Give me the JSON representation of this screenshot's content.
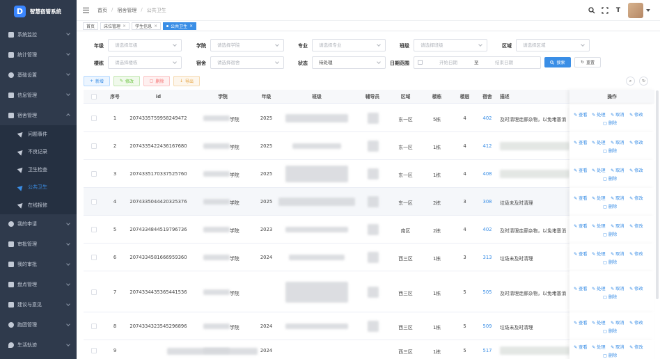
{
  "app": {
    "title": "智慧宿管系统",
    "logo_letter": "D"
  },
  "sidebar": {
    "items": [
      {
        "label": "系统监控",
        "icon": "monitor-icon"
      },
      {
        "label": "统计管理",
        "icon": "bar-chart-icon"
      },
      {
        "label": "基础设置",
        "icon": "gear-icon"
      },
      {
        "label": "信息管理",
        "icon": "document-icon"
      },
      {
        "label": "宿舍管理",
        "icon": "building-icon"
      }
    ],
    "sub_items": [
      {
        "label": "问题事件"
      },
      {
        "label": "不良记录"
      },
      {
        "label": "卫生检查"
      },
      {
        "label": "公共卫生"
      },
      {
        "label": "在线报修"
      }
    ],
    "bottom_items": [
      {
        "label": "我的申请",
        "icon": "user-icon"
      },
      {
        "label": "审批管理",
        "icon": "document-icon"
      },
      {
        "label": "我的审批",
        "icon": "document-icon"
      },
      {
        "label": "盘点管理",
        "icon": "grid-icon"
      },
      {
        "label": "建议与意见",
        "icon": "chat-icon"
      },
      {
        "label": "跑团管理",
        "icon": "gear-icon"
      },
      {
        "label": "生活轨迹",
        "icon": "pin-icon"
      }
    ]
  },
  "header": {
    "breadcrumb": [
      "首页",
      "宿舍管理",
      "公共卫生"
    ],
    "font_size_icon_text": "T"
  },
  "tabs": [
    {
      "label": "首页",
      "closable": false
    },
    {
      "label": "床位管理",
      "closable": true
    },
    {
      "label": "学生信息",
      "closable": true
    },
    {
      "label": "公共卫生",
      "closable": true,
      "active": true
    }
  ],
  "filters": {
    "grade": {
      "label": "年级",
      "placeholder": "请选择年级"
    },
    "college": {
      "label": "学院",
      "placeholder": "请选择学院"
    },
    "major": {
      "label": "专业",
      "placeholder": "请选择专业"
    },
    "class": {
      "label": "班级",
      "placeholder": "请选择班级"
    },
    "area": {
      "label": "区域",
      "placeholder": "请选择区域"
    },
    "building": {
      "label": "楼栋",
      "placeholder": "请选择楼栋"
    },
    "dorm": {
      "label": "宿舍",
      "placeholder": "请选择宿舍"
    },
    "status": {
      "label": "状态",
      "value": "待处理"
    },
    "date_range": {
      "label": "日期范围",
      "start_placeholder": "开始日期",
      "sep": "至",
      "end_placeholder": "结束日期"
    },
    "search_label": "搜索",
    "reset_label": "重置"
  },
  "toolbar": {
    "add": "新增",
    "edit": "修改",
    "delete": "删除",
    "export": "导出"
  },
  "table": {
    "columns": [
      "序号",
      "id",
      "学院",
      "年级",
      "班级",
      "辅导员",
      "区域",
      "楼栋",
      "楼层",
      "宿舍",
      "描述",
      "操作"
    ],
    "actions": {
      "view": "查看",
      "handle": "处理",
      "cancel": "取消",
      "edit": "修改",
      "delete": "删除"
    },
    "rows": [
      {
        "no": "1",
        "id": "2074335759958249472",
        "college": "学院",
        "grade": "2025",
        "area": "东一区",
        "building": "5栋",
        "floor": "4",
        "dorm": "402",
        "desc": "及时清理走廊杂物，以免堵塞消"
      },
      {
        "no": "2",
        "id": "2074335422436167680",
        "college": "学院",
        "grade": "2025",
        "area": "东一区",
        "building": "1栋",
        "floor": "4",
        "dorm": "412",
        "desc": ""
      },
      {
        "no": "3",
        "id": "2074335170337525760",
        "college": "学院",
        "grade": "2025",
        "area": "东一区",
        "building": "1栋",
        "floor": "4",
        "dorm": "408",
        "desc": ""
      },
      {
        "no": "4",
        "id": "2074335044420325376",
        "college": "学院",
        "grade": "2025",
        "area": "东一区",
        "building": "2栋",
        "floor": "3",
        "dorm": "308",
        "desc": "垃圾未及时清理"
      },
      {
        "no": "5",
        "id": "2074334844519796736",
        "college": "学院",
        "grade": "2023",
        "area": "南区",
        "building": "2栋",
        "floor": "4",
        "dorm": "402",
        "desc": "及时清理走廊杂物，以免堵塞消"
      },
      {
        "no": "6",
        "id": "2074334581666959360",
        "college": "学院",
        "grade": "2024",
        "area": "西三区",
        "building": "1栋",
        "floor": "3",
        "dorm": "313",
        "desc": "垃圾未及时清理"
      },
      {
        "no": "7",
        "id": "2074334435365441536",
        "college": "学院",
        "grade": "",
        "area": "西三区",
        "building": "1栋",
        "floor": "5",
        "dorm": "505",
        "desc": "及时清理走廊杂物，以免堵塞消"
      },
      {
        "no": "8",
        "id": "2074334323545296896",
        "college": "学院",
        "grade": "2024",
        "area": "西三区",
        "building": "1栋",
        "floor": "5",
        "dorm": "509",
        "desc": "垃圾未及时清理"
      },
      {
        "no": "9",
        "id": "",
        "college": "",
        "grade": "2024",
        "area": "西三区",
        "building": "1栋",
        "floor": "5",
        "dorm": "517",
        "desc": ""
      }
    ]
  },
  "colors": {
    "sidebar_bg": "#2f3a4c",
    "accent": "#3a8ee6"
  }
}
